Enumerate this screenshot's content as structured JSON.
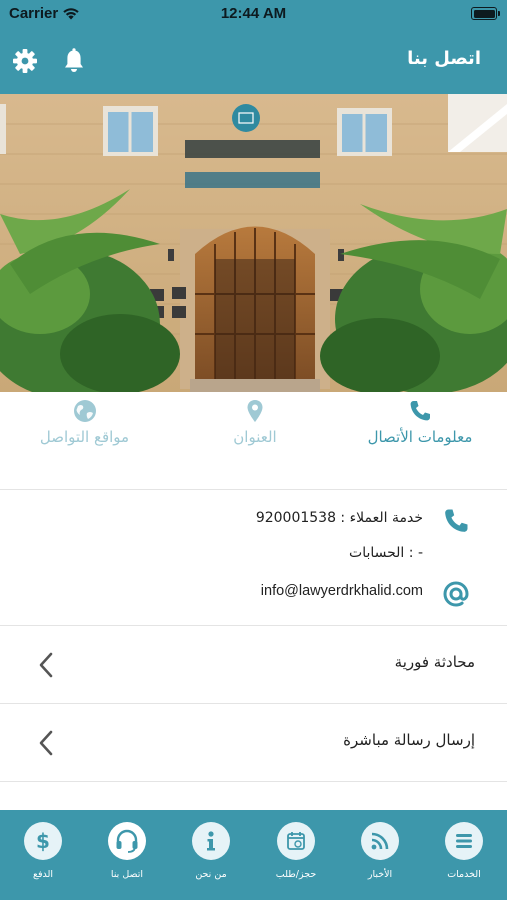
{
  "status_bar": {
    "carrier": "Carrier",
    "time": "12:44 AM"
  },
  "nav": {
    "title": "اتصل بنا"
  },
  "tabs": [
    {
      "label": "معلومات الأتصال",
      "icon": "phone-icon",
      "active": true
    },
    {
      "label": "العنوان",
      "icon": "location-pin-icon",
      "active": false
    },
    {
      "label": "مواقع التواصل",
      "icon": "globe-icon",
      "active": false
    }
  ],
  "contact": {
    "customer_service": "خدمة العملاء : 920001538",
    "accounts": "الحسابات : -",
    "email": "info@lawyerdrkhalid.com"
  },
  "menu": [
    {
      "label": "محادثة فورية"
    },
    {
      "label": "إرسال رسالة مباشرة"
    }
  ],
  "tabbar": [
    {
      "label": "الدفع",
      "icon": "dollar-icon"
    },
    {
      "label": "اتصل بنا",
      "icon": "headset-icon",
      "active": true
    },
    {
      "label": "من نحن",
      "icon": "info-icon"
    },
    {
      "label": "حجز/طلب",
      "icon": "calendar-icon"
    },
    {
      "label": "الأخبار",
      "icon": "rss-icon"
    },
    {
      "label": "الخدمات",
      "icon": "menu-icon"
    }
  ],
  "colors": {
    "primary": "#3d97ab",
    "tab_inactive": "#9fc9d4"
  }
}
